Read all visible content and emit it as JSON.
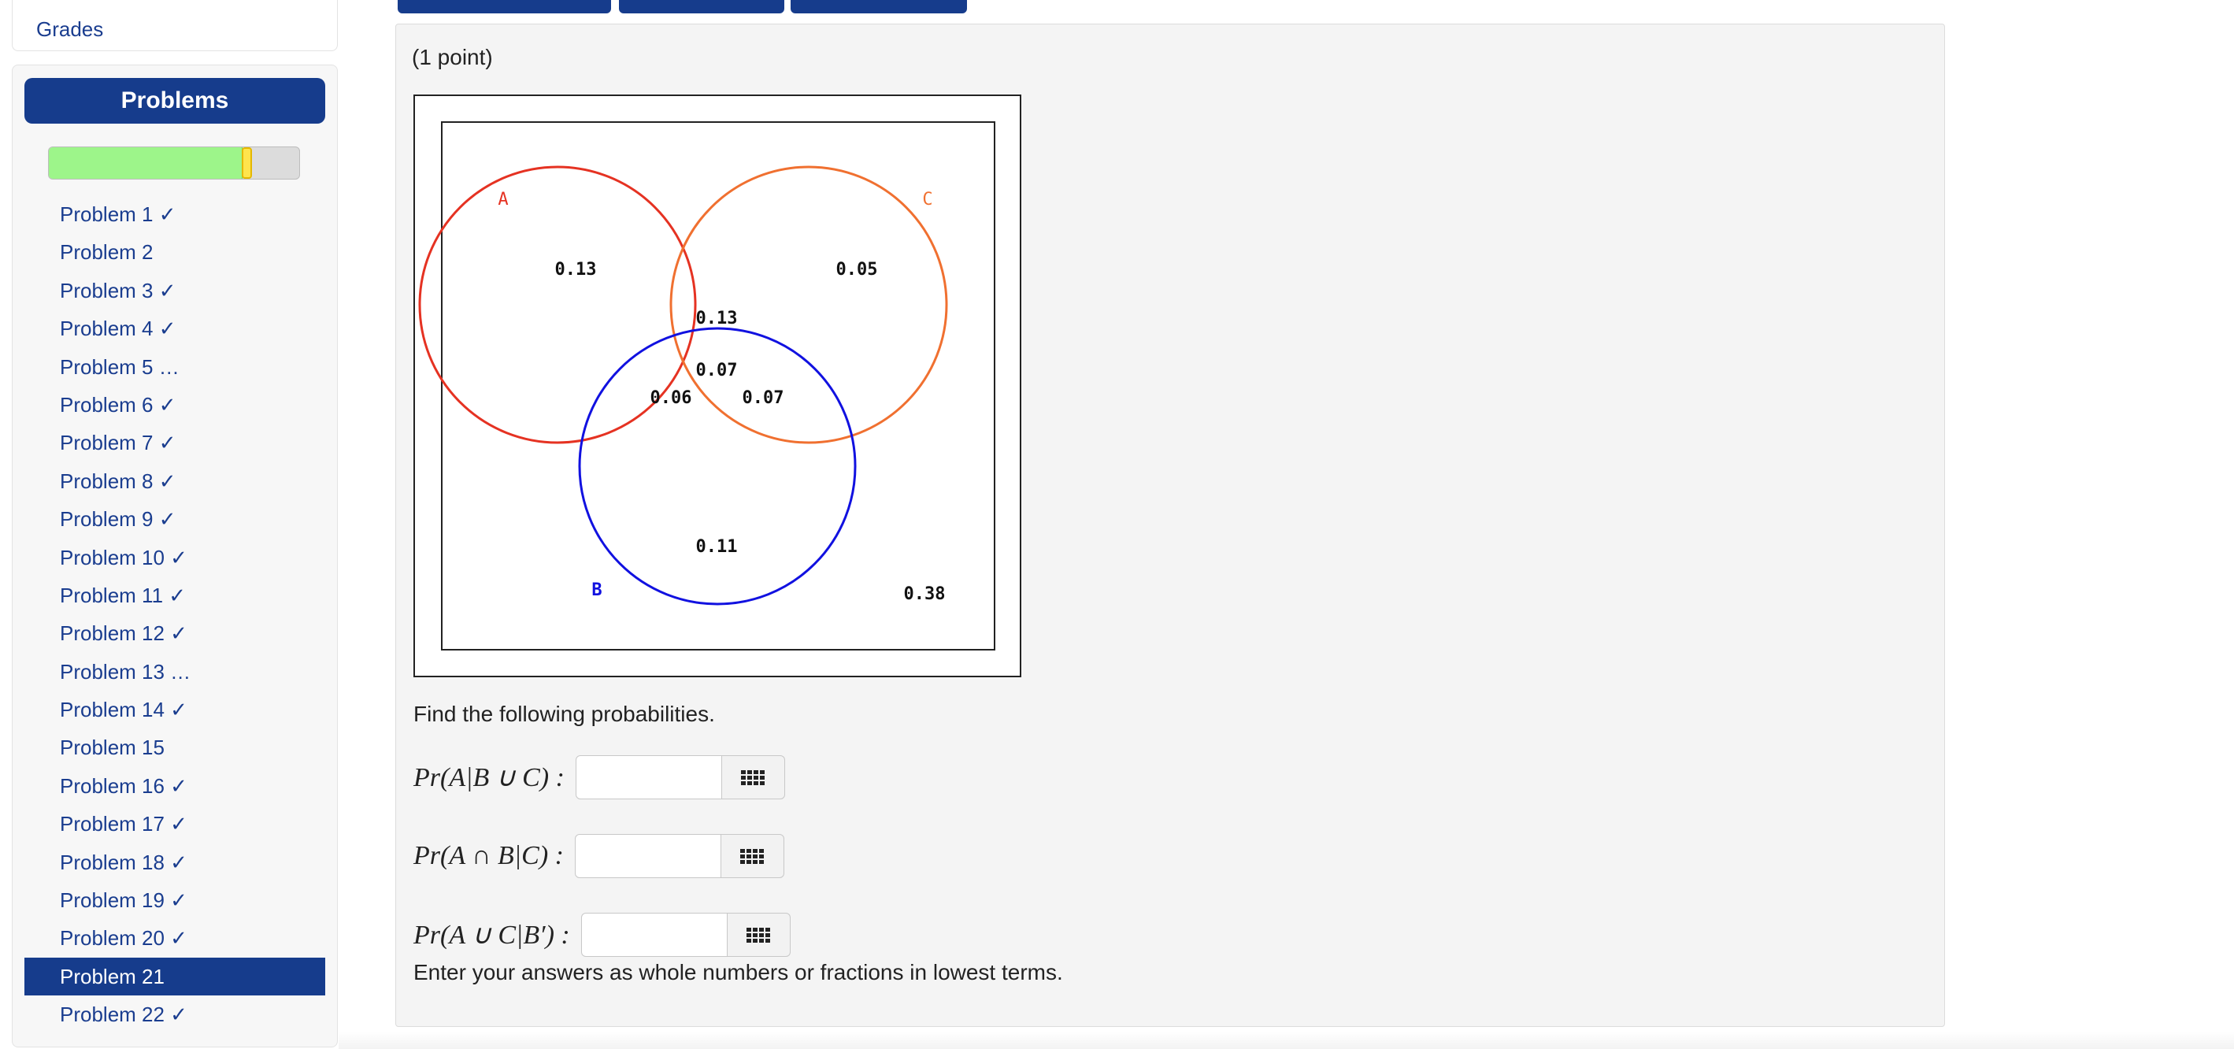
{
  "sidebar": {
    "grades_label": "Grades",
    "problems_header": "Problems",
    "progress": {
      "correct_fraction": 0.77,
      "partial_fraction": 0.04
    },
    "items": [
      {
        "label": "Problem 1 ✓"
      },
      {
        "label": "Problem 2"
      },
      {
        "label": "Problem 3 ✓"
      },
      {
        "label": "Problem 4 ✓"
      },
      {
        "label": "Problem 5 …"
      },
      {
        "label": "Problem 6 ✓"
      },
      {
        "label": "Problem 7 ✓"
      },
      {
        "label": "Problem 8 ✓"
      },
      {
        "label": "Problem 9 ✓"
      },
      {
        "label": "Problem 10 ✓"
      },
      {
        "label": "Problem 11 ✓"
      },
      {
        "label": "Problem 12 ✓"
      },
      {
        "label": "Problem 13 …"
      },
      {
        "label": "Problem 14 ✓"
      },
      {
        "label": "Problem 15"
      },
      {
        "label": "Problem 16 ✓"
      },
      {
        "label": "Problem 17 ✓"
      },
      {
        "label": "Problem 18 ✓"
      },
      {
        "label": "Problem 19 ✓"
      },
      {
        "label": "Problem 20 ✓"
      },
      {
        "label": "Problem 21",
        "active": true
      },
      {
        "label": "Problem 22 ✓"
      }
    ]
  },
  "problem": {
    "points": "(1 point)",
    "venn": {
      "labels": {
        "A": "A",
        "B": "B",
        "C": "C"
      },
      "colors": {
        "A": "#e53222",
        "B": "#1111e0",
        "C": "#f07030"
      },
      "regions": {
        "A_only": "0.13",
        "C_only": "0.05",
        "A_C_only": "0.13",
        "A_B_C": "0.07",
        "A_B_only": "0.06",
        "B_C_only": "0.07",
        "B_only": "0.11",
        "outside": "0.38"
      }
    },
    "instruction": "Find the following probabilities.",
    "questions": [
      {
        "label": "Pr(A|B ∪ C) :",
        "value": "",
        "placeholder": ""
      },
      {
        "label": "Pr(A ∩ B|C) :",
        "value": "",
        "placeholder": ""
      },
      {
        "label": "Pr(A ∪ C|B′) :",
        "value": "",
        "placeholder": ""
      }
    ],
    "note": "Enter your answers as whole numbers or fractions in lowest terms."
  },
  "icons": {
    "answer_tool": "keypad-grid-icon"
  }
}
